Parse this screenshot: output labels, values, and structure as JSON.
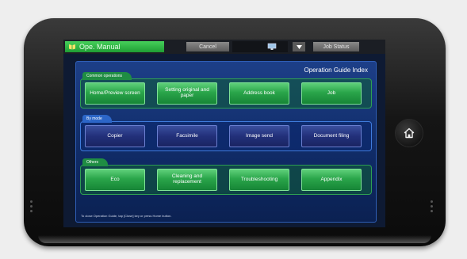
{
  "top_bar": {
    "manual_tab_label": "Ope. Manual",
    "cancel_label": "Cancel",
    "job_status_label": "Job Status"
  },
  "panel": {
    "title": "Operation Guide Index",
    "groups": [
      {
        "label": "Common operations",
        "buttons": [
          "Home/Preview screen",
          "Setting original and paper",
          "Address book",
          "Job"
        ]
      },
      {
        "label": "By mode",
        "buttons": [
          "Copier",
          "Facsimile",
          "Image send",
          "Document filing"
        ]
      },
      {
        "label": "Others",
        "buttons": [
          "Eco",
          "Cleaning and replacement",
          "Troubleshooting",
          "Appendix"
        ]
      }
    ],
    "footer_note": "To close Operation Guide, tap [Close] key or press Home button."
  },
  "colors": {
    "manual_tab": "#2fae45",
    "panel_bg": "#163a80",
    "green_button": "#2aa54a",
    "navy_button": "#22307a"
  },
  "icons": {
    "manual_tab": "book-icon",
    "dropdown": "triangle-down-icon",
    "status": "monitor-icon",
    "home": "home-icon"
  }
}
